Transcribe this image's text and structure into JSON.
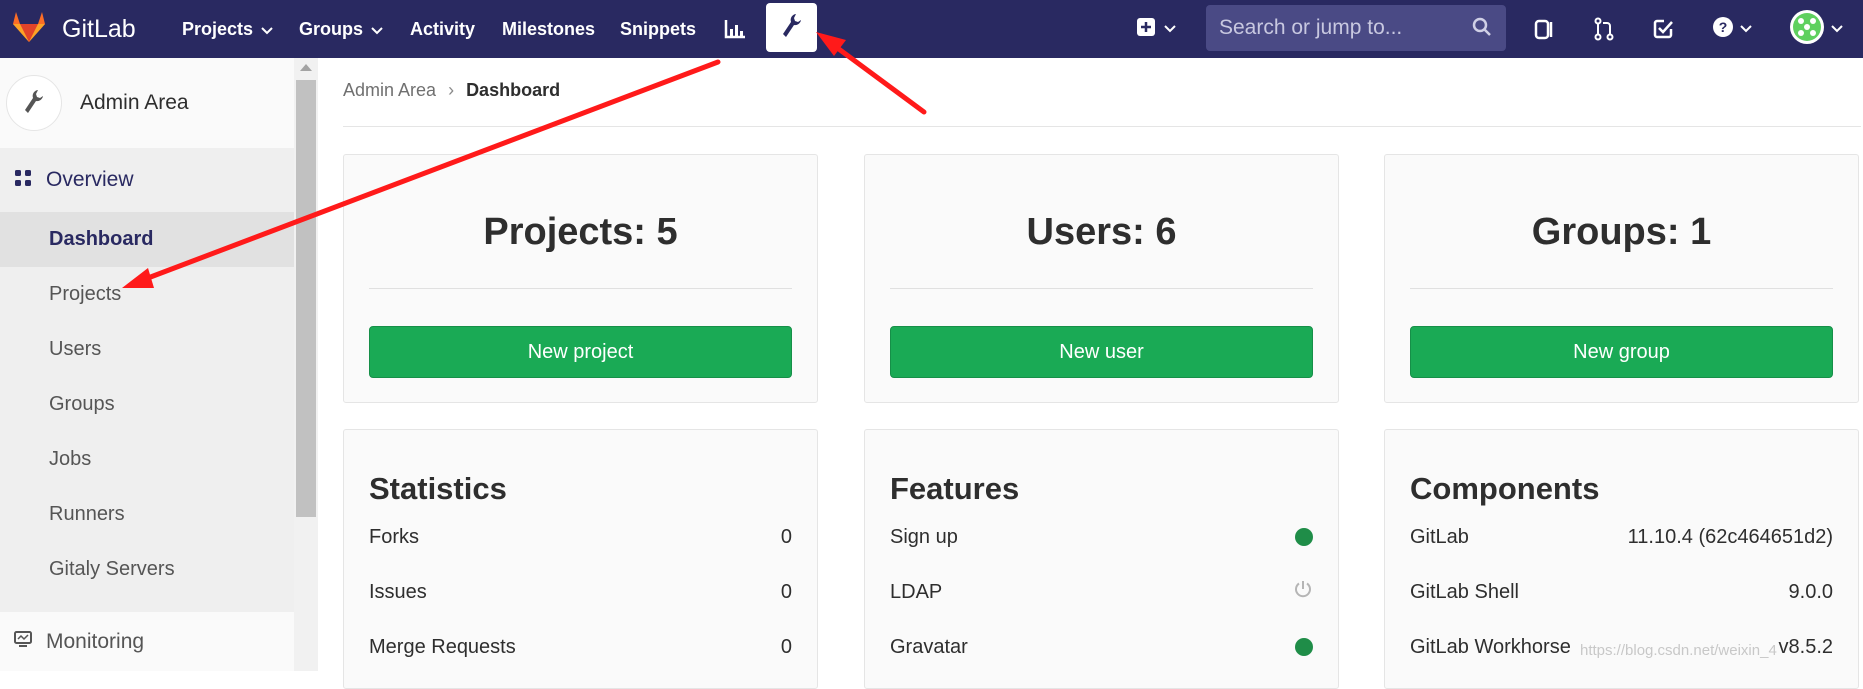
{
  "navbar": {
    "brand": "GitLab",
    "items": [
      {
        "label": "Projects",
        "dropdown": true
      },
      {
        "label": "Groups",
        "dropdown": true
      },
      {
        "label": "Activity",
        "dropdown": false
      },
      {
        "label": "Milestones",
        "dropdown": false
      },
      {
        "label": "Snippets",
        "dropdown": false
      }
    ],
    "search_placeholder": "Search or jump to...",
    "icons": [
      "chart-icon",
      "wrench-icon",
      "plus-square-icon",
      "issues-icon",
      "merge-request-icon",
      "todo-icon",
      "help-icon",
      "user-avatar"
    ]
  },
  "sidebar": {
    "context_title": "Admin Area",
    "overview_label": "Overview",
    "items": [
      {
        "label": "Dashboard",
        "active": true
      },
      {
        "label": "Projects",
        "active": false
      },
      {
        "label": "Users",
        "active": false
      },
      {
        "label": "Groups",
        "active": false
      },
      {
        "label": "Jobs",
        "active": false
      },
      {
        "label": "Runners",
        "active": false
      },
      {
        "label": "Gitaly Servers",
        "active": false
      }
    ],
    "monitoring_label": "Monitoring"
  },
  "breadcrumb": {
    "parent": "Admin Area",
    "current": "Dashboard"
  },
  "stats_cards": [
    {
      "title": "Projects: 5",
      "button": "New project"
    },
    {
      "title": "Users: 6",
      "button": "New user"
    },
    {
      "title": "Groups: 1",
      "button": "New group"
    }
  ],
  "statistics": {
    "title": "Statistics",
    "rows": [
      {
        "label": "Forks",
        "value": "0"
      },
      {
        "label": "Issues",
        "value": "0"
      },
      {
        "label": "Merge Requests",
        "value": "0"
      }
    ]
  },
  "features": {
    "title": "Features",
    "rows": [
      {
        "label": "Sign up",
        "status": "on"
      },
      {
        "label": "LDAP",
        "status": "off"
      },
      {
        "label": "Gravatar",
        "status": "on"
      }
    ]
  },
  "components": {
    "title": "Components",
    "rows": [
      {
        "label": "GitLab",
        "value": "11.10.4 (62c464651d2)"
      },
      {
        "label": "GitLab Shell",
        "value": "9.0.0"
      },
      {
        "label": "GitLab Workhorse",
        "value": "v8.5.2"
      }
    ]
  },
  "watermark": "https://blog.csdn.net/weixin_4",
  "colors": {
    "navbar": "#292961",
    "accent_green": "#1aaa55",
    "annotation_arrow": "#ff1a1a"
  }
}
